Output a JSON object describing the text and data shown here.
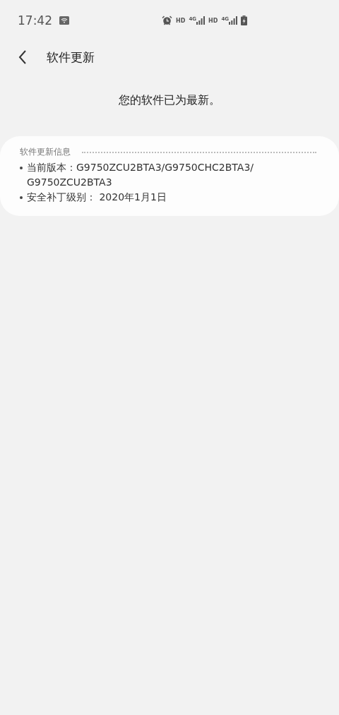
{
  "status_bar": {
    "time": "17:42",
    "sim_1": {
      "hd": "HD",
      "network": "4G"
    },
    "sim_2": {
      "hd": "HD",
      "network": "4G"
    }
  },
  "header": {
    "title": "软件更新"
  },
  "message": "您的软件已为最新。",
  "info_card": {
    "heading": "软件更新信息",
    "items": [
      {
        "lines": [
          "当前版本：G9750ZCU2BTA3/G9750CHC2BTA3/",
          "G9750ZCU2BTA3"
        ]
      },
      {
        "lines": [
          "安全补丁级别： 2020年1月1日"
        ]
      }
    ]
  }
}
